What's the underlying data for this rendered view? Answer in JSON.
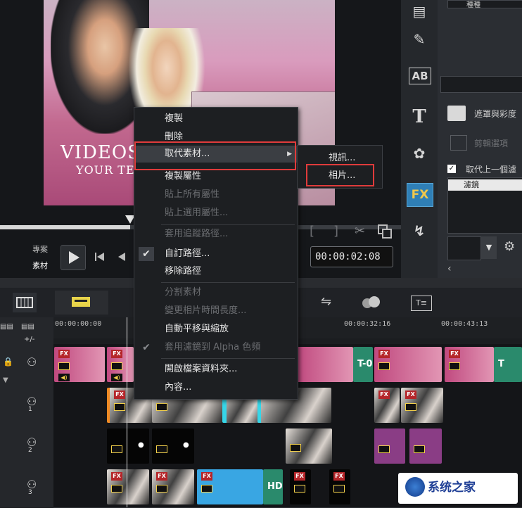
{
  "preview": {
    "title_line1": "VIDEOS",
    "title_line2": "YOUR TEX",
    "project_label": "專案",
    "clip_label": "素材",
    "timecode": "00:00:02:08"
  },
  "right_panel": {
    "top_label": "種種",
    "adjust_label": "遮罩與彩度",
    "edit_label": "剪輯選項",
    "replace_label": "取代上一個濾",
    "filter_item": "濾鏡",
    "fx_label": "FX",
    "title_icon": "T",
    "ab_icon": "AB"
  },
  "context_menu": {
    "items": [
      {
        "label": "複製",
        "disabled": false
      },
      {
        "label": "刪除",
        "disabled": false
      },
      {
        "label": "取代素材...",
        "disabled": false,
        "submenu": true
      },
      {
        "label": "複製屬性",
        "disabled": false
      },
      {
        "label": "貼上所有屬性",
        "disabled": true
      },
      {
        "label": "貼上選用屬性...",
        "disabled": true
      },
      {
        "label": "套用追蹤路徑...",
        "disabled": true
      },
      {
        "label": "自訂路徑...",
        "disabled": false,
        "checked": true
      },
      {
        "label": "移除路徑",
        "disabled": false
      },
      {
        "label": "分割素材",
        "disabled": true
      },
      {
        "label": "變更相片時間長度...",
        "disabled": true
      },
      {
        "label": "自動平移與縮放",
        "disabled": false
      },
      {
        "label": "套用濾鏡到 Alpha 色頻",
        "disabled": true,
        "checked": true
      },
      {
        "label": "開啟檔案資料夾...",
        "disabled": false
      },
      {
        "label": "內容...",
        "disabled": false
      }
    ]
  },
  "submenu": {
    "video": "視訊...",
    "photo": "相片..."
  },
  "timeline": {
    "ruler": [
      "00:00:00:00",
      "00:00:32:16",
      "00:00:43:13"
    ],
    "transition_label": "T-0",
    "hd_label": "HD",
    "track_numbers": [
      "1",
      "2",
      "3"
    ],
    "plus_minus": "+/-"
  },
  "watermark": {
    "text": "系统之家"
  }
}
